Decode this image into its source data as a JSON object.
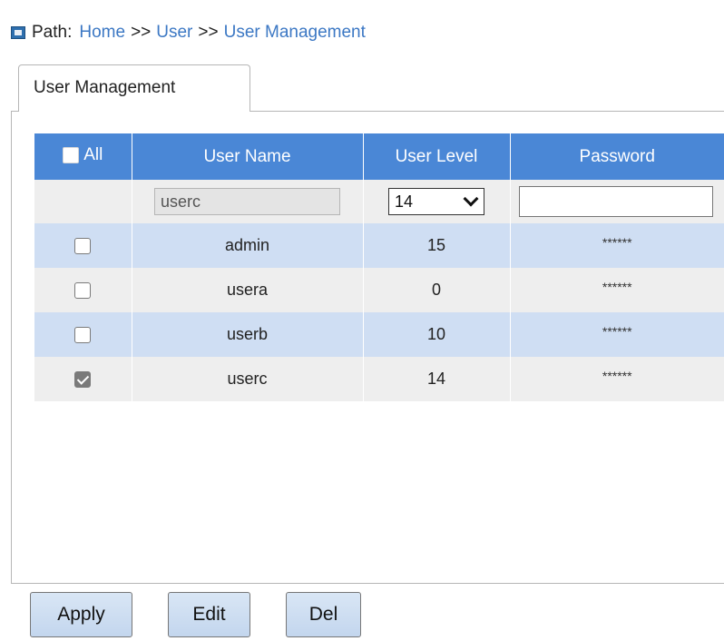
{
  "path": {
    "label": "Path:",
    "crumbs": [
      "Home",
      "User",
      "User Management"
    ],
    "separator": ">>"
  },
  "tab": {
    "label": "User Management"
  },
  "table": {
    "select_all_label": "All",
    "headers": [
      "User Name",
      "User Level",
      "Password"
    ],
    "edit_row": {
      "user_name": "userc",
      "user_level": "14",
      "password": ""
    },
    "rows": [
      {
        "checked": false,
        "user_name": "admin",
        "user_level": "15",
        "password": "******"
      },
      {
        "checked": false,
        "user_name": "usera",
        "user_level": "0",
        "password": "******"
      },
      {
        "checked": false,
        "user_name": "userb",
        "user_level": "10",
        "password": "******"
      },
      {
        "checked": true,
        "user_name": "userc",
        "user_level": "14",
        "password": "******"
      }
    ]
  },
  "buttons": {
    "apply": "Apply",
    "edit": "Edit",
    "del": "Del"
  },
  "colors": {
    "header_bg": "#4a87d6",
    "row_blue": "#cfdef3",
    "row_grey": "#eeeeee",
    "link": "#3c78c4"
  }
}
